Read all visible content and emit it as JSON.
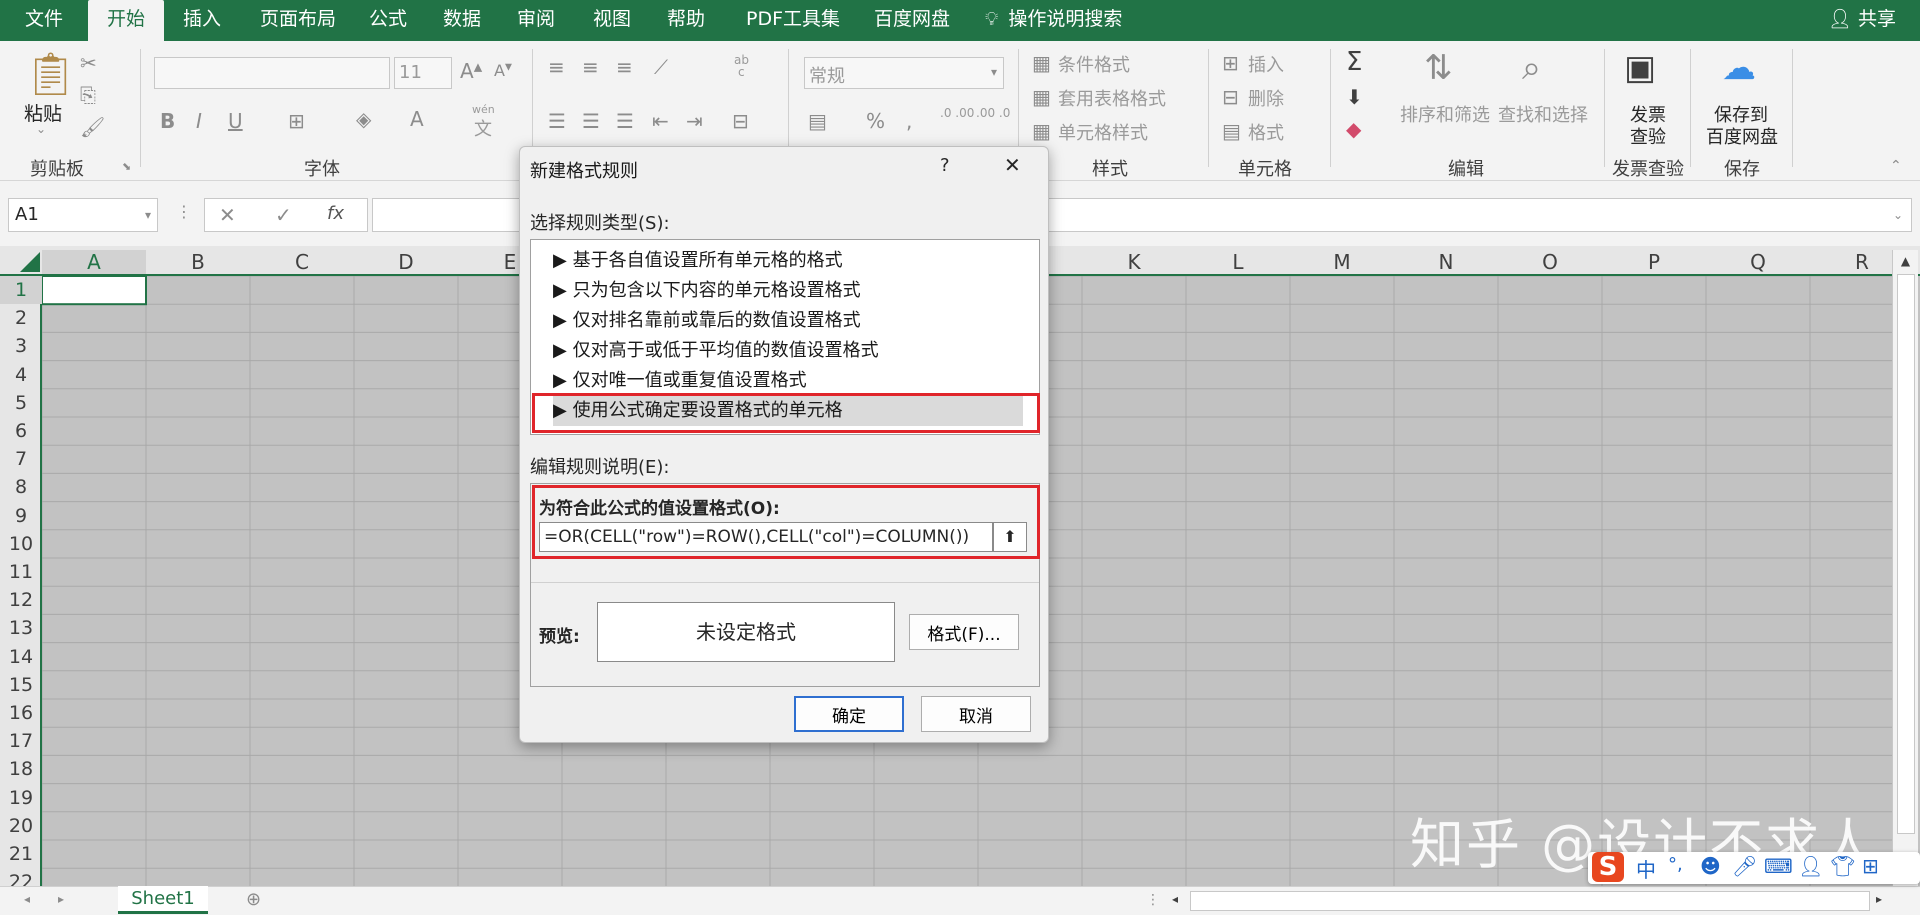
{
  "tabs": [
    "文件",
    "开始",
    "插入",
    "页面布局",
    "公式",
    "数据",
    "审阅",
    "视图",
    "帮助",
    "PDF工具集",
    "百度网盘"
  ],
  "active_tab": "开始",
  "tell_me": "操作说明搜索",
  "share": "共享",
  "ribbon": {
    "clipboard": {
      "paste": "粘贴",
      "label": "剪贴板"
    },
    "font": {
      "size": "11",
      "label": "字体",
      "wen": "wén",
      "wen_char": "文"
    },
    "alignment": {
      "ab": "ab",
      "c": "c"
    },
    "number": {
      "format": "常规",
      "dec_inc": ".0 .00",
      "dec_dec": ".00 .0"
    },
    "styles": {
      "conditional": "条件格式",
      "table": "套用表格格式",
      "cell": "单元格样式",
      "label": "样式"
    },
    "cells": {
      "insert": "插入",
      "delete": "删除",
      "format": "格式",
      "label": "单元格"
    },
    "editing": {
      "sort": "排序和筛选",
      "find": "查找和选择",
      "label": "编辑"
    },
    "invoice": {
      "button_l1": "发票",
      "button_l2": "查验",
      "label": "发票查验"
    },
    "save": {
      "button_l1": "保存到",
      "button_l2": "百度网盘",
      "label": "保存"
    }
  },
  "formula_bar": {
    "name_box": "A1",
    "fx": "fx"
  },
  "columns": [
    "A",
    "B",
    "C",
    "D",
    "E",
    "",
    "",
    "",
    "",
    "",
    "K",
    "L",
    "M",
    "N",
    "O",
    "P",
    "Q",
    "R"
  ],
  "rows": [
    "1",
    "2",
    "3",
    "4",
    "5",
    "6",
    "7",
    "8",
    "9",
    "10",
    "11",
    "12",
    "13",
    "14",
    "15",
    "16",
    "17",
    "18",
    "19",
    "20",
    "21",
    "22"
  ],
  "sheet_tab": "Sheet1",
  "dialog": {
    "title": "新建格式规则",
    "help": "?",
    "close": "✕",
    "rule_type_label": "选择规则类型(S):",
    "rule_types": [
      "基于各自值设置所有单元格的格式",
      "只为包含以下内容的单元格设置格式",
      "仅对排名靠前或靠后的数值设置格式",
      "仅对高于或低于平均值的数值设置格式",
      "仅对唯一值或重复值设置格式",
      "使用公式确定要设置格式的单元格"
    ],
    "selected_rule_index": 5,
    "edit_label": "编辑规则说明(E):",
    "formula_label": "为符合此公式的值设置格式(O):",
    "formula_value": "=OR(CELL(\"row\")=ROW(),CELL(\"col\")=COLUMN())",
    "preview_label": "预览:",
    "preview_text": "未设定格式",
    "format_button": "格式(F)...",
    "ok": "确定",
    "cancel": "取消"
  },
  "watermark": "知乎 @设计不求人",
  "ime": {
    "label": "中"
  },
  "colors": {
    "excel_green": "#217346",
    "highlight_red": "#e0252a"
  }
}
